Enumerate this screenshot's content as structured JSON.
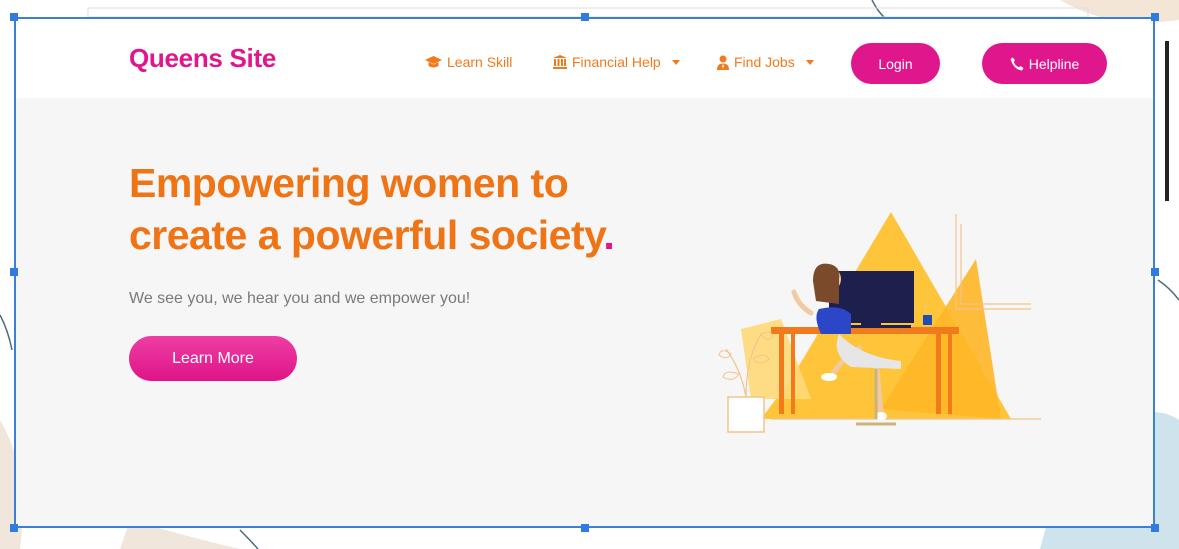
{
  "brand": {
    "name": "Queens Site"
  },
  "nav": {
    "items": [
      {
        "label": "Learn Skill",
        "icon": "graduation-cap-icon",
        "has_dropdown": false
      },
      {
        "label": "Financial Help",
        "icon": "bank-icon",
        "has_dropdown": true
      },
      {
        "label": "Find Jobs",
        "icon": "user-tie-icon",
        "has_dropdown": true
      }
    ],
    "login_label": "Login",
    "helpline_label": "Helpline",
    "helpline_icon": "phone-icon"
  },
  "hero": {
    "title_line1": "Empowering women to",
    "title_line2": "create a powerful society",
    "title_dot": ".",
    "subtitle": "We see you, we hear you and we empower you!",
    "cta_label": "Learn More"
  },
  "colors": {
    "brand_pink": "#e0168c",
    "accent_orange": "#ef7415",
    "hero_bg": "#f6f6f6",
    "selection_blue": "#2f7be0"
  }
}
